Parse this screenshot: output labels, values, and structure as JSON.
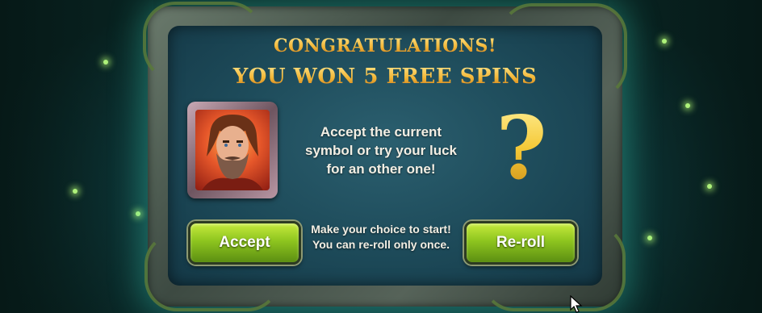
{
  "dialog": {
    "title": "CONGRATULATIONS!",
    "subtitle": "YOU WON 5 FREE SPINS",
    "message": "Accept the current\nsymbol or try your luck\nfor an other one!",
    "hint": "Make your choice to start!\nYou can re-roll only once.",
    "mystery_symbol": "?",
    "current_symbol": "bearded-hero-portrait"
  },
  "buttons": {
    "accept_label": "Accept",
    "reroll_label": "Re-roll"
  },
  "colors": {
    "title_gold": "#f2b636",
    "button_green": "#8ec51f",
    "panel_teal": "#1d4a59",
    "glow": "#aef27a"
  },
  "cursor_icon": "arrow-cursor-icon"
}
